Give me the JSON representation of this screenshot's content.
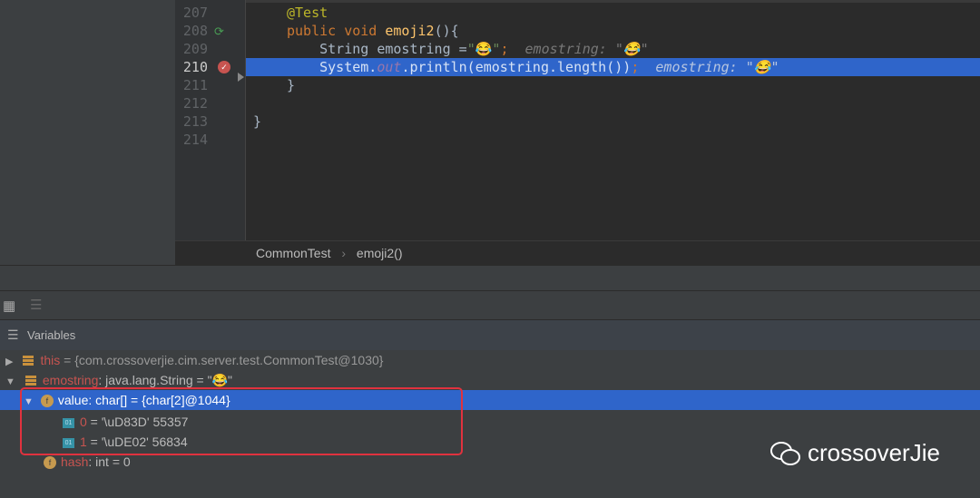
{
  "editor": {
    "lines": [
      {
        "num": "207"
      },
      {
        "num": "208"
      },
      {
        "num": "209"
      },
      {
        "num": "210"
      },
      {
        "num": "211"
      },
      {
        "num": "212"
      },
      {
        "num": "213"
      },
      {
        "num": "214"
      }
    ],
    "code": {
      "l207": "@Test",
      "l208_kw": "public void ",
      "l208_fn": "emoji2",
      "l208_rest": "(){",
      "l209_a": "    String emostring =",
      "l209_str": "\"😂\"",
      "l209_semi": ";",
      "l209_hint": "  emostring: \"😂\"",
      "l210_a": "    System.",
      "l210_out": "out",
      "l210_b": ".println(emostring.length())",
      "l210_semi": ";",
      "l210_hint": "  emostring: \"😂\"",
      "l211": "}",
      "l213": "}"
    }
  },
  "breadcrumb": {
    "class": "CommonTest",
    "sep": "›",
    "method": "emoji2()"
  },
  "variables": {
    "title": "Variables",
    "rows": [
      {
        "name": "this",
        "value": " = {com.crossoverjie.cim.server.test.CommonTest@1030}"
      },
      {
        "name": "emostring",
        "type": ": java.lang.String",
        "value": "  = \"😂\""
      },
      {
        "name": "value",
        "type": ": char[]",
        "value": "  = {char[2]@1044}"
      },
      {
        "name": "0",
        "value": " = '\\uD83D' 55357"
      },
      {
        "name": "1",
        "value": " = '\\uDE02' 56834"
      },
      {
        "name": "hash",
        "type": ": int",
        "value": "  = 0"
      }
    ]
  },
  "watermark": "crossoverJie"
}
